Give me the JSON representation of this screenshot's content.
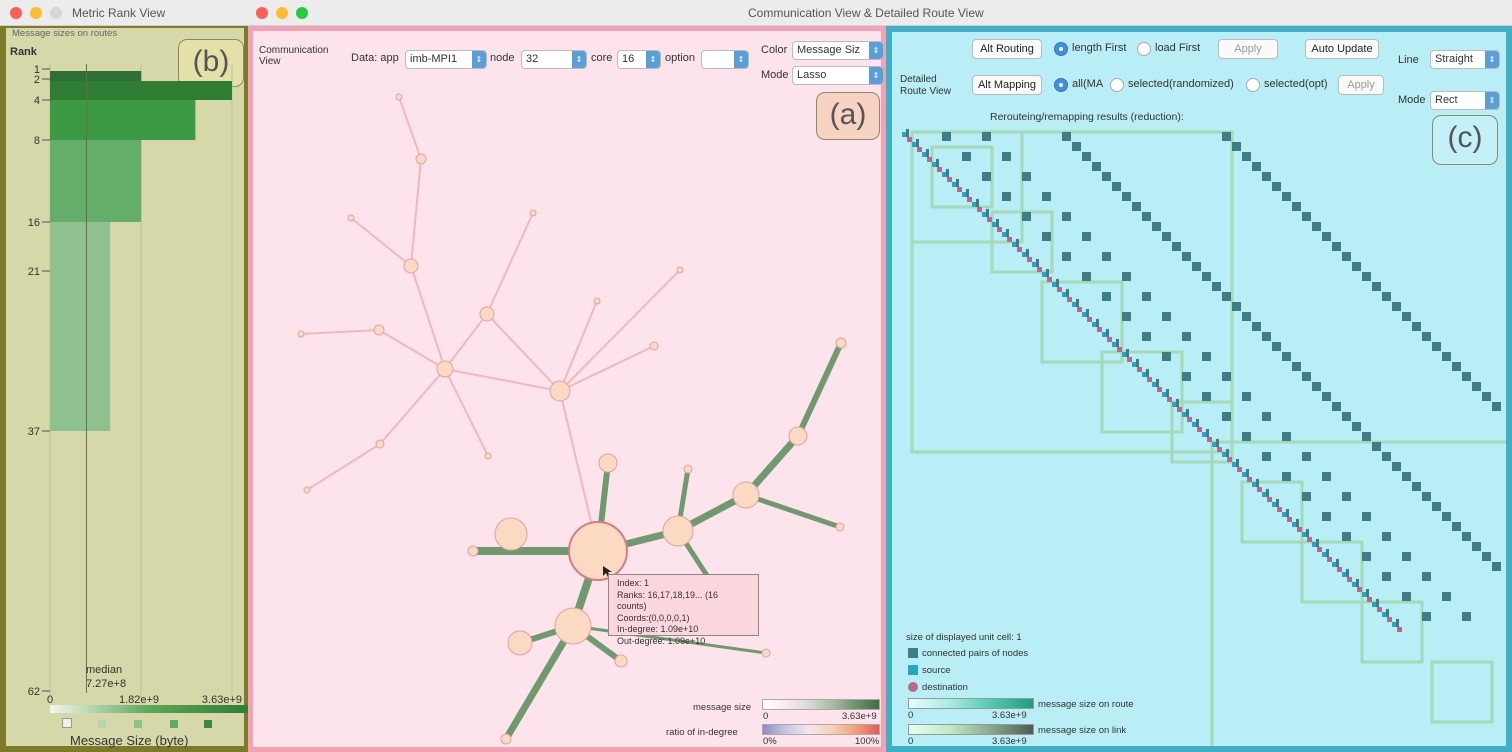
{
  "windows": {
    "left_title": "Metric Rank View",
    "right_title": "Communication View & Detailed Route View"
  },
  "panel_b": {
    "tag": "(b)",
    "header": "Message sizes on routes",
    "rank_label": "Rank",
    "rank_ticks": [
      "1",
      "2",
      "4",
      "8",
      "16",
      "21",
      "37",
      "62"
    ],
    "median_label": "median",
    "median_value": "7.27e+8",
    "x_ticks": [
      "0",
      "1.82e+9",
      "3.63e+9"
    ],
    "x_label": "Message Size (byte)"
  },
  "panel_a": {
    "tag": "(a)",
    "view_label_1": "Communication",
    "view_label_2": "View",
    "data_label": "Data: app",
    "data_value": "imb-MPI1",
    "node_label": "node",
    "node_value": "32",
    "core_label": "core",
    "core_value": "16",
    "option_label": "option",
    "option_value": "",
    "color_label": "Color",
    "color_value": "Message Siz",
    "mode_label": "Mode",
    "mode_value": "Lasso",
    "tooltip": {
      "index": "Index: 1",
      "ranks": "Ranks: 16,17,18,19... (16 counts)",
      "coords": "Coords:(0,0,0,0,1)",
      "indegree": "In-degree: 1.09e+10",
      "outdegree": "Out-degree: 1.09e+10"
    },
    "legend_message_size": "message size",
    "legend_ms_min": "0",
    "legend_ms_max": "3.63e+9",
    "legend_ratio": "ratio of in-degree",
    "legend_ratio_min": "0%",
    "legend_ratio_max": "100%",
    "colors": {
      "edge_green": "#6f9a6f",
      "node_fill": "#fcd9c2",
      "edge_pink": "#f0b8c0"
    }
  },
  "panel_c": {
    "tag": "(c)",
    "view_label_1": "Detailed",
    "view_label_2": "Route View",
    "alt_routing": "Alt Routing",
    "length_first": "length First",
    "load_first": "load First",
    "apply1": "Apply",
    "auto_update": "Auto Update",
    "alt_mapping": "Alt Mapping",
    "all_ma": "all(MA",
    "selected_random": "selected(randomized)",
    "selected_opt": "selected(opt)",
    "apply2": "Apply",
    "line_label": "Line",
    "line_value": "Straight",
    "mode_label": "Mode",
    "mode_value": "Rect",
    "results_label": "Rerouteing/remapping results (reduction):",
    "unit_cell": "size of displayed unit cell: 1",
    "legend_connected": "connected pairs of nodes",
    "legend_source": "source",
    "legend_destination": "destination",
    "legend_route": "message size on route",
    "legend_route_min": "0",
    "legend_route_max": "3.63e+9",
    "legend_link": "message size on link",
    "legend_link_min": "0",
    "legend_link_max": "3.63e+9",
    "colors": {
      "cell": "#3f7d86",
      "source": "#27a5c7",
      "destination": "#b46a8a"
    }
  },
  "chart_data": {
    "type": "bar",
    "title": "Message sizes on routes",
    "ylabel": "Rank",
    "xlabel": "Message Size (byte)",
    "categories": [
      "1",
      "2",
      "4",
      "8",
      "16",
      "37"
    ],
    "values": [
      1820000000.0,
      3630000000.0,
      2900000000.0,
      1820000000.0,
      1200000000.0,
      900000000.0
    ],
    "xlim": [
      0,
      3630000000.0
    ],
    "median": 727000000.0
  }
}
